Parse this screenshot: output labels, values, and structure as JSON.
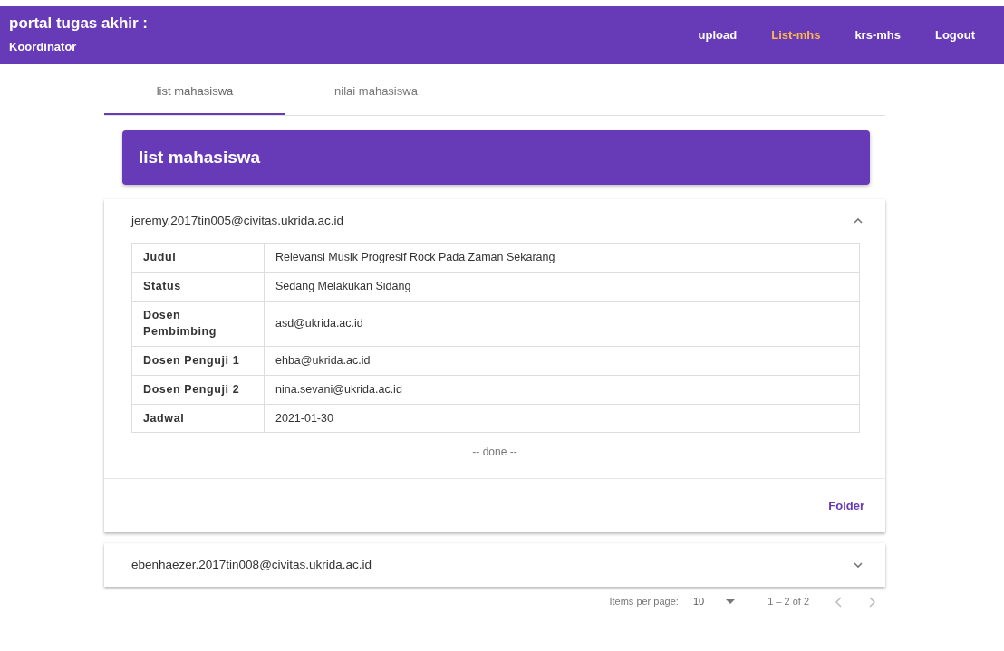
{
  "navbar": {
    "title": "portal tugas akhir :",
    "subtitle": "Koordinator",
    "links": [
      {
        "label": "upload",
        "selected": false
      },
      {
        "label": "List-mhs",
        "selected": true
      },
      {
        "label": "krs-mhs",
        "selected": false
      },
      {
        "label": "Logout",
        "selected": false
      }
    ]
  },
  "tabs": [
    {
      "label": "list mahasiswa",
      "selected": true
    },
    {
      "label": "nilai mahasiswa",
      "selected": false
    }
  ],
  "header": {
    "title": "list mahasiswa"
  },
  "panels": [
    {
      "email": "jeremy.2017tin005@civitas.ukrida.ac.id",
      "expanded": true,
      "rows": [
        {
          "label": "Judul",
          "value": "Relevansi Musik Progresif Rock Pada Zaman Sekarang"
        },
        {
          "label": "Status",
          "value": "Sedang Melakukan Sidang"
        },
        {
          "label": "Dosen Pembimbing",
          "value": "asd@ukrida.ac.id"
        },
        {
          "label": "Dosen Penguji 1",
          "value": "ehba@ukrida.ac.id"
        },
        {
          "label": "Dosen Penguji 2",
          "value": "nina.sevani@ukrida.ac.id"
        },
        {
          "label": "Jadwal",
          "value": "2021-01-30"
        }
      ],
      "note": "-- done --",
      "action": "Folder"
    },
    {
      "email": "ebenhaezer.2017tin008@civitas.ukrida.ac.id",
      "expanded": false
    }
  ],
  "paginator": {
    "label": "Items per page:",
    "page_size": "10",
    "range": "1 – 2 of 2"
  }
}
